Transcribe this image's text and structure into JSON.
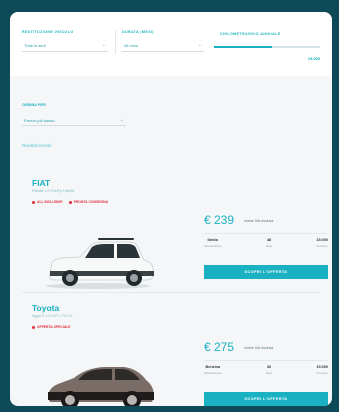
{
  "search": {
    "destination_label": "RESTITUZIONE VEICOLO",
    "destination_value": "Tutte le sedi",
    "duration_label": "DURATA (MESI)",
    "duration_value": "48 mesi",
    "km_label": "CHILOMETRAGGIO ANNUALE",
    "km_value": "15.000",
    "km_level": 0.55
  },
  "filters": {
    "sort_label": "ORDINA PER",
    "sort_value": "Prezzo più basso",
    "results": "Risultati trovati"
  },
  "offers": [
    {
      "brand": "FIAT",
      "model": "Panda 1.0 FireFly Hybrid",
      "tags": [
        "ALL INCLUSIVE",
        "PRONTA CONSEGNA"
      ],
      "price": "€ 239",
      "price_note": "/mese IVA esclusa",
      "specs": [
        {
          "value": "Ibrido",
          "label": "Alimentazione"
        },
        {
          "value": "48",
          "label": "Mesi"
        },
        {
          "value": "15.000",
          "label": "Km/anno"
        }
      ],
      "cta": "SCOPRI L'OFFERTA"
    },
    {
      "brand": "Toyota",
      "model": "Aygo X 1.0 VVT-i 72 CV",
      "tags": [
        "OFFERTA SPECIALE"
      ],
      "price": "€ 275",
      "price_note": "/mese IVA esclusa",
      "specs": [
        {
          "value": "Benzina",
          "label": "Alimentazione"
        },
        {
          "value": "36",
          "label": "Mesi"
        },
        {
          "value": "15.000",
          "label": "Km/anno"
        }
      ],
      "cta": "SCOPRI L'OFFERTA"
    }
  ],
  "colors": {
    "accent": "#1ab2c2",
    "tag": "#e0303f",
    "background": "#0e4a57"
  }
}
